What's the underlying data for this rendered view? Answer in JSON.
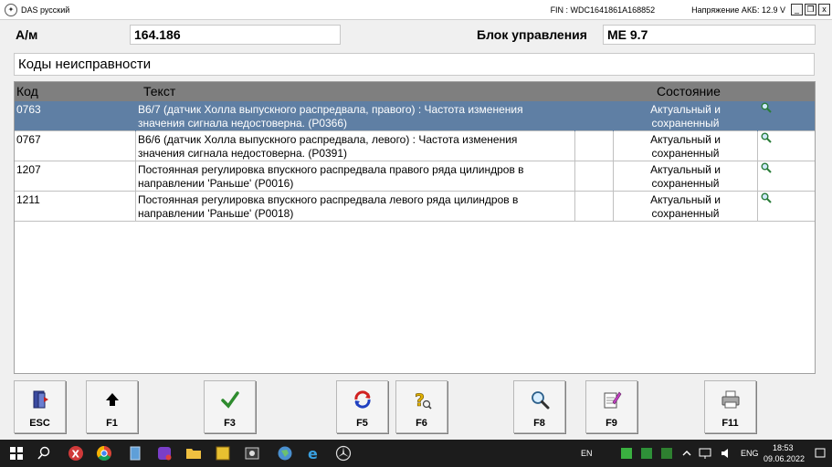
{
  "window": {
    "title": "DAS русский",
    "fin": "FIN : WDC1641861A168852",
    "battery": "Напряжение АКБ: 12.9 V",
    "controls": [
      "_",
      "❐",
      "x"
    ]
  },
  "header": {
    "am_label": "A/м",
    "am_value": "164.186",
    "unit_label": "Блок управления",
    "unit_value": "ME 9.7",
    "section_title": "Коды неисправности"
  },
  "table": {
    "columns": {
      "code": "Код",
      "text": "Текст",
      "state": "Состояние"
    },
    "rows": [
      {
        "code": "0763",
        "text_line1": "B6/7 (датчик Холла выпускного распредвала, правого) : Частота изменения",
        "text_line2": "значения сигнала недостоверна. (P0366)",
        "state_line1": "Актуальный и",
        "state_line2": "сохраненный",
        "selected": true
      },
      {
        "code": "0767",
        "text_line1": "B6/6 (датчик Холла выпускного распредвала, левого) : Частота изменения",
        "text_line2": "значения сигнала недостоверна. (P0391)",
        "state_line1": "Актуальный и",
        "state_line2": "сохраненный",
        "selected": false
      },
      {
        "code": "1207",
        "text_line1": "Постоянная регулировка впускного распредвала правого ряда цилиндров в",
        "text_line2": "направлении 'Раньше' (P0016)",
        "state_line1": "Актуальный и",
        "state_line2": "сохраненный",
        "selected": false
      },
      {
        "code": "1211",
        "text_line1": "Постоянная регулировка впускного распредвала левого ряда цилиндров в",
        "text_line2": "направлении 'Раньше' (P0018)",
        "state_line1": "Актуальный и",
        "state_line2": "сохраненный",
        "selected": false
      }
    ]
  },
  "fkeys": [
    {
      "label": "ESC",
      "icon": "exit-door-icon"
    },
    {
      "label": "F1",
      "icon": "arrow-up-icon"
    },
    {
      "label": "F3",
      "icon": "checkmark-icon"
    },
    {
      "label": "F5",
      "icon": "refresh-icon"
    },
    {
      "label": "F6",
      "icon": "help-question-icon"
    },
    {
      "label": "F8",
      "icon": "magnifier-icon"
    },
    {
      "label": "F9",
      "icon": "notepad-edit-icon"
    },
    {
      "label": "F11",
      "icon": "printer-icon"
    }
  ],
  "taskbar": {
    "lang1": "EN",
    "lang2": "ENG",
    "time": "18:53",
    "date": "09.06.2022"
  },
  "colors": {
    "selected_row": "#5f7fa4",
    "header_row": "#7f7f7f"
  }
}
